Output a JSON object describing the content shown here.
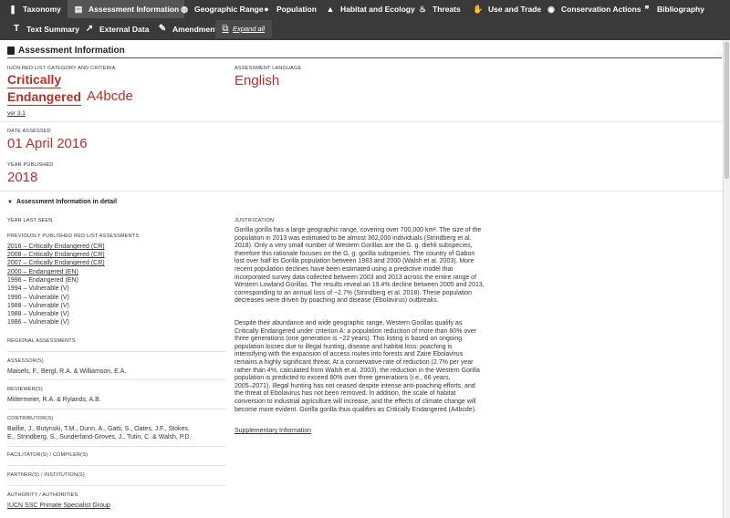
{
  "nav": {
    "row1": [
      {
        "icon": "taxonomy-icon",
        "glyph": "❚",
        "label": "Taxonomy"
      },
      {
        "icon": "assessment-icon",
        "glyph": "▤",
        "label": "Assessment Information"
      },
      {
        "icon": "globe-icon",
        "glyph": "◍",
        "label": "Geographic Range"
      },
      {
        "icon": "population-icon",
        "glyph": "●",
        "label": "Population"
      },
      {
        "icon": "habitat-icon",
        "glyph": "▲",
        "label": "Habitat and Ecology"
      },
      {
        "icon": "threats-icon",
        "glyph": "♨",
        "label": "Threats"
      },
      {
        "icon": "trade-icon",
        "glyph": "✋",
        "label": "Use and Trade"
      },
      {
        "icon": "conservation-icon",
        "glyph": "◉",
        "label": "Conservation Actions"
      },
      {
        "icon": "bibliography-icon",
        "glyph": "❞",
        "label": "Bibliography"
      }
    ],
    "row2": [
      {
        "icon": "text-icon",
        "glyph": "T",
        "label": "Text Summary"
      },
      {
        "icon": "external-link-icon",
        "glyph": "↗",
        "label": "External Data"
      },
      {
        "icon": "pencil-icon",
        "glyph": "✎",
        "label": "Amendment"
      }
    ],
    "expand_all": "Expand all"
  },
  "section": {
    "title": "Assessment Information"
  },
  "category": {
    "label": "IUCN Red List Category and Criteria",
    "line1": "Critically",
    "line2": "Endangered",
    "criteria": "A4bcde",
    "version": "ver 3.1"
  },
  "language": {
    "label": "Assessment Language",
    "value": "English"
  },
  "date_assessed": {
    "label": "Date Assessed",
    "value": "01 April 2016"
  },
  "year_published": {
    "label": "Year Published",
    "value": "2018"
  },
  "detail_toggle": "Assessment Information in detail",
  "left": {
    "year_last_seen": "Year last seen",
    "prev_label": "Previously published Red List assessments",
    "prev": [
      "2016 – Critically Endangered (CR)",
      "2008 – Critically Endangered (CR)",
      "2007 – Critically Endangered (CR)",
      "2000 – Endangered (EN)",
      "1996 – Endangered (EN)",
      "1994 – Vulnerable (V)",
      "1990 – Vulnerable (V)",
      "1988 – Vulnerable (V)",
      "1988 – Vulnerable (V)",
      "1986 – Vulnerable (V)"
    ],
    "regional": "Regional assessments",
    "assessors_label": "Assessor(s)",
    "assessors": "Maisels, F., Bergl, R.A. & Williamson, E.A.",
    "reviewers_label": "Reviewer(s)",
    "reviewers": "Mittermeier, R.A. & Rylands, A.B.",
    "contributors_label": "Contributor(s)",
    "contributors1": "Baillie, J., Butynski, T.M., Dunn, A., Gatti, S., Oates, J.F., Stokes,",
    "contributors2": "E., Strindberg, S., Sunderland-Groves, J., Tutin, C. & Walsh, P.D.",
    "facilitators_label": "Facilitator(s) / Compiler(s)",
    "partners_label": "Partner(s) / Institution(s)",
    "authority_label": "Authority / Authorities",
    "authority": "IUCN SSC Primate Specialist Group"
  },
  "justification": {
    "label": "Justification",
    "p1": [
      "Gorilla gorilla has a large geographic range, covering over 700,000 km². The size of the",
      "population in 2013 was estimated to be almost 362,000 individuals  (Strindberg et al.",
      "2018). Only a very small number of Western Gorillas are the G. g. diehli subspecies,",
      "therefore this rationale focuses on the G. g. gorilla subspecies. The country of Gabon",
      "lost over half its Gorilla population between 1983 and 2000 (Walsh et al. 2003). More",
      "recent population declines have been estimated using a predictive model that",
      "incorporated survey data collected between 2003 and 2013 across the entire range of",
      "Western Lowland Gorillas. The results reveal an 19.4% decline between 2005 and 2013,",
      "corresponding to an annual loss of ~2.7% (Strindberg et al. 2018). These population",
      "decreases were driven by poaching and disease (Ebolavirus) outbreaks."
    ],
    "p2": [
      "Despite their abundance and wide geographic range, Western Gorillas qualify as",
      "Critically Endangered under criterion A: a population reduction of more than 80% over",
      "three generations (one generation is ~22 years). This listing is based on ongoing",
      "population losses due to illegal hunting, disease and habitat loss: poaching is",
      "intensifying with the expansion of access routes into forests and Zaire Ebolavirus",
      "remains a highly significant threat. At a conservative rate of reduction (2.7% per year",
      "rather than 4%, calculated from Walsh et al. 2003), the reduction in the Western Gorilla",
      "population is predicted to exceed 80% over three generations (i.e., 66 years,",
      "2005–2071). Illegal hunting has not ceased despite intense anti-poaching efforts, and",
      "the threat of Ebolavirus has not been removed. In addition, the scale of habitat",
      "conversion to industrial agriculture will increase, and the effects of climate change will",
      "become more evident. Gorilla gorilla thus qualifies as Critically Endangered (A4bcde)."
    ],
    "supplementary": "Supplementary Information"
  }
}
